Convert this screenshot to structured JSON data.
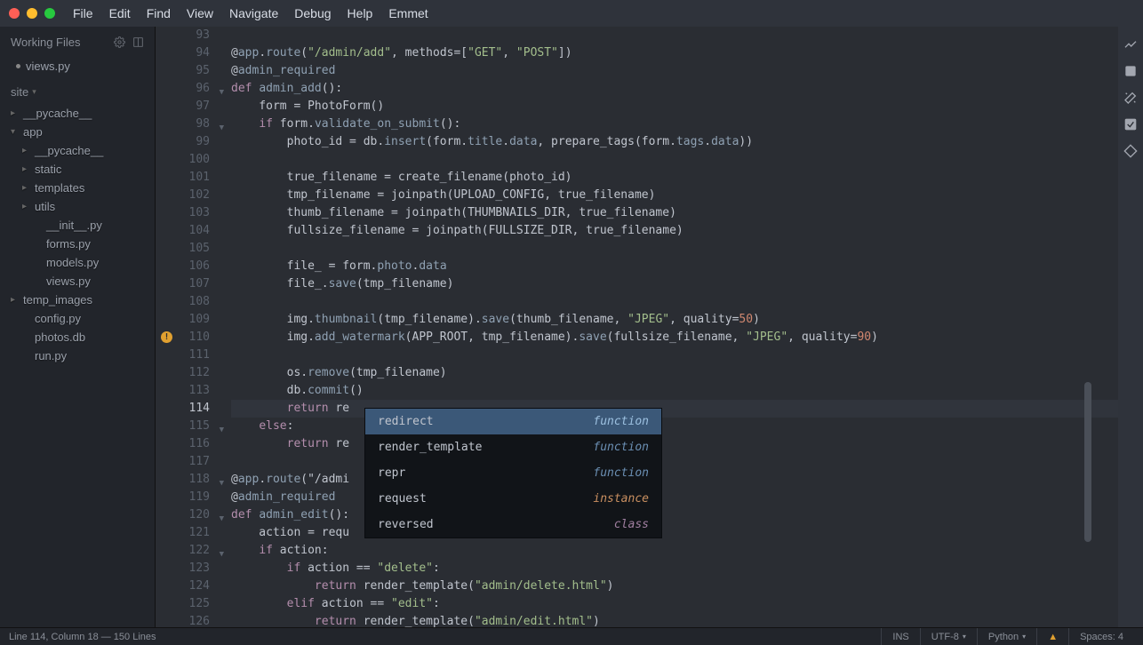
{
  "menu": [
    "File",
    "Edit",
    "Find",
    "View",
    "Navigate",
    "Debug",
    "Help",
    "Emmet"
  ],
  "workingFiles": {
    "title": "Working Files",
    "items": [
      "views.py"
    ]
  },
  "project": {
    "name": "site",
    "tree": [
      {
        "label": "__pycache__",
        "depth": 0,
        "arrow": "▸"
      },
      {
        "label": "app",
        "depth": 0,
        "arrow": "▾"
      },
      {
        "label": "__pycache__",
        "depth": 1,
        "arrow": "▸"
      },
      {
        "label": "static",
        "depth": 1,
        "arrow": "▸"
      },
      {
        "label": "templates",
        "depth": 1,
        "arrow": "▸"
      },
      {
        "label": "utils",
        "depth": 1,
        "arrow": "▸"
      },
      {
        "label": "__init__.py",
        "depth": 2,
        "arrow": ""
      },
      {
        "label": "forms.py",
        "depth": 2,
        "arrow": ""
      },
      {
        "label": "models.py",
        "depth": 2,
        "arrow": ""
      },
      {
        "label": "views.py",
        "depth": 2,
        "arrow": ""
      },
      {
        "label": "temp_images",
        "depth": 0,
        "arrow": "▸"
      },
      {
        "label": "config.py",
        "depth": 1,
        "arrow": ""
      },
      {
        "label": "photos.db",
        "depth": 1,
        "arrow": ""
      },
      {
        "label": "run.py",
        "depth": 1,
        "arrow": ""
      }
    ]
  },
  "gutter": {
    "start": 93,
    "end": 126,
    "active": 114,
    "folds": [
      96,
      98,
      115,
      118,
      120,
      122
    ],
    "warn": 110
  },
  "code": {
    "93": "",
    "94": "@app.route(\"/admin/add\", methods=[\"GET\", \"POST\"])",
    "95": "@admin_required",
    "96": "def admin_add():",
    "97": "    form = PhotoForm()",
    "98": "    if form.validate_on_submit():",
    "99": "        photo_id = db.insert(form.title.data, prepare_tags(form.tags.data))",
    "100": "",
    "101": "        true_filename = create_filename(photo_id)",
    "102": "        tmp_filename = joinpath(UPLOAD_CONFIG, true_filename)",
    "103": "        thumb_filename = joinpath(THUMBNAILS_DIR, true_filename)",
    "104": "        fullsize_filename = joinpath(FULLSIZE_DIR, true_filename)",
    "105": "",
    "106": "        file_ = form.photo.data",
    "107": "        file_.save(tmp_filename)",
    "108": "",
    "109": "        img.thumbnail(tmp_filename).save(thumb_filename, \"JPEG\", quality=50)",
    "110": "        img.add_watermark(APP_ROOT, tmp_filename).save(fullsize_filename, \"JPEG\", quality=90)",
    "111": "",
    "112": "        os.remove(tmp_filename)",
    "113": "        db.commit()",
    "114": "        return re",
    "115": "    else:",
    "116": "        return re                               orm)",
    "117": "",
    "118": "@app.route(\"/admi",
    "119": "@admin_required",
    "120": "def admin_edit():",
    "121": "    action = requ",
    "122": "    if action:",
    "123": "        if action == \"delete\":",
    "124": "            return render_template(\"admin/delete.html\")",
    "125": "        elif action == \"edit\":",
    "126": "            return render_template(\"admin/edit.html\")"
  },
  "autocomplete": [
    {
      "name": "redirect",
      "kind": "function",
      "sel": true
    },
    {
      "name": "render_template",
      "kind": "function"
    },
    {
      "name": "repr",
      "kind": "function"
    },
    {
      "name": "request",
      "kind": "instance"
    },
    {
      "name": "reversed",
      "kind": "class"
    }
  ],
  "status": {
    "pos": "Line 114, Column 18 — 150 Lines",
    "ins": "INS",
    "encoding": "UTF-8",
    "lang": "Python",
    "indent": "Spaces: 4"
  }
}
